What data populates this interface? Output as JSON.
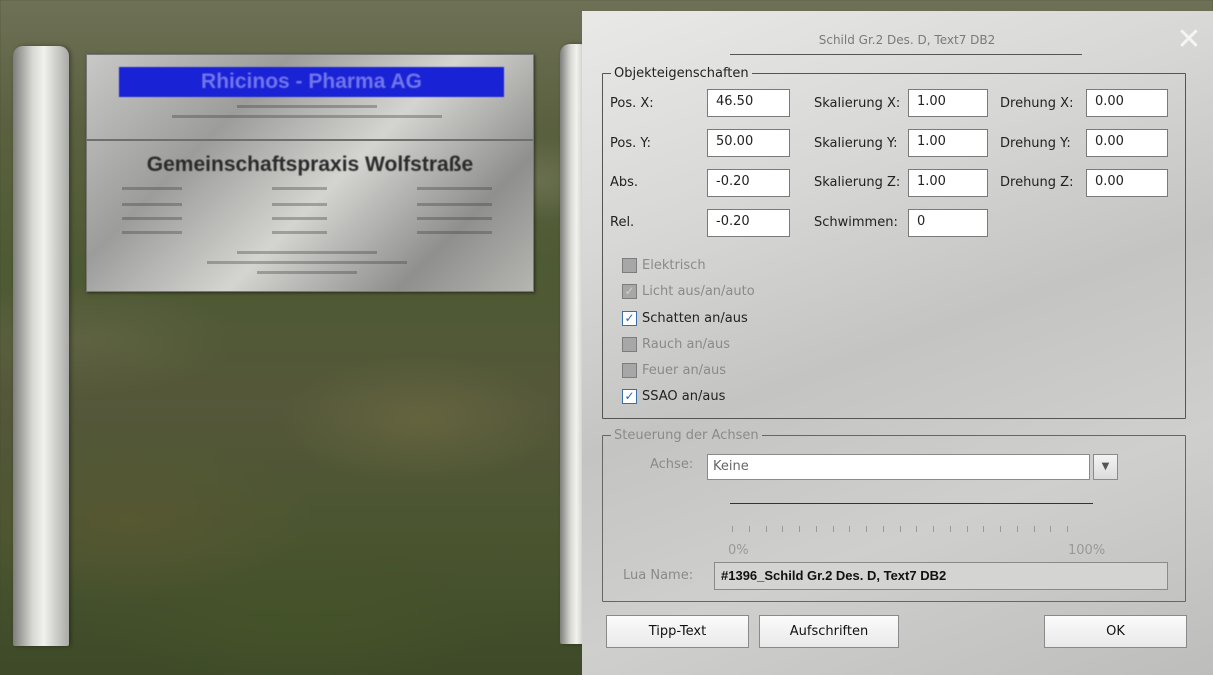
{
  "scene": {
    "sign_banner": "Rhicinos - Pharma AG",
    "sign_title": "Gemeinschaftspraxis Wolfstraße"
  },
  "dialog": {
    "title": "Schild Gr.2 Des. D, Text7 DB2",
    "close_icon": "close-icon",
    "properties": {
      "legend": "Objekteigenschaften",
      "pos_x_label": "Pos. X:",
      "pos_x_value": "46.50",
      "pos_y_label": "Pos. Y:",
      "pos_y_value": "50.00",
      "abs_label": "Abs.",
      "abs_value": "-0.20",
      "rel_label": "Rel.",
      "rel_value": "-0.20",
      "scale_x_label": "Skalierung X:",
      "scale_x_value": "1.00",
      "scale_y_label": "Skalierung Y:",
      "scale_y_value": "1.00",
      "scale_z_label": "Skalierung Z:",
      "scale_z_value": "1.00",
      "swim_label": "Schwimmen:",
      "swim_value": "0",
      "rot_x_label": "Drehung X:",
      "rot_x_value": "0.00",
      "rot_y_label": "Drehung Y:",
      "rot_y_value": "0.00",
      "rot_z_label": "Drehung Z:",
      "rot_z_value": "0.00",
      "checkboxes": [
        {
          "label": "Elektrisch",
          "checked": false,
          "enabled": false
        },
        {
          "label": "Licht aus/an/auto",
          "checked": true,
          "enabled": false
        },
        {
          "label": "Schatten an/aus",
          "checked": true,
          "enabled": true
        },
        {
          "label": "Rauch an/aus",
          "checked": false,
          "enabled": false
        },
        {
          "label": "Feuer an/aus",
          "checked": false,
          "enabled": false
        },
        {
          "label": "SSAO an/aus",
          "checked": true,
          "enabled": true
        }
      ]
    },
    "axes": {
      "legend": "Steuerung der Achsen",
      "axis_label": "Achse:",
      "axis_value": "Keine",
      "min_label": "0%",
      "max_label": "100%",
      "lua_label": "Lua Name:",
      "lua_value": "#1396_Schild Gr.2 Des. D, Text7 DB2"
    },
    "buttons": {
      "tipp_text": "Tipp-Text",
      "aufschriften": "Aufschriften",
      "ok": "OK"
    }
  }
}
